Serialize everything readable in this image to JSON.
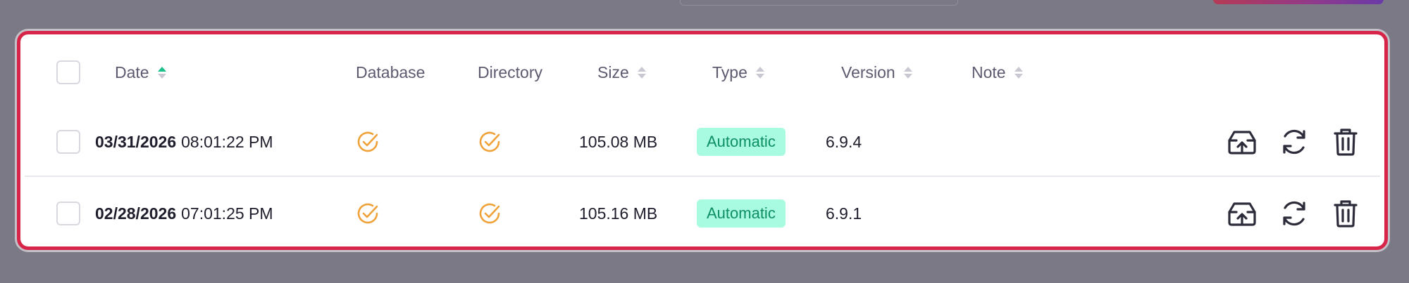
{
  "table": {
    "columns": {
      "date": "Date",
      "database": "Database",
      "directory": "Directory",
      "size": "Size",
      "type": "Type",
      "version": "Version",
      "note": "Note"
    },
    "rows": [
      {
        "date": "03/31/2026",
        "time": "08:01:22 PM",
        "database": "check-circle-icon",
        "directory": "check-circle-icon",
        "size": "105.08 MB",
        "type": "Automatic",
        "version": "6.9.4",
        "note": "",
        "actions": [
          "restore-icon",
          "refresh-icon",
          "trash-icon"
        ]
      },
      {
        "date": "02/28/2026",
        "time": "07:01:25 PM",
        "database": "check-circle-icon",
        "directory": "check-circle-icon",
        "size": "105.16 MB",
        "type": "Automatic",
        "version": "6.9.1",
        "note": "",
        "actions": [
          "restore-icon",
          "refresh-icon",
          "trash-icon"
        ]
      }
    ],
    "sort": {
      "column": "date",
      "direction": "ascending"
    }
  },
  "colors": {
    "highlight_border": "#d7254a",
    "check": "#f0a23a",
    "badge_bg": "#a8fbe0",
    "badge_text": "#0e8f63",
    "sort_active": "#1bbf8a"
  }
}
